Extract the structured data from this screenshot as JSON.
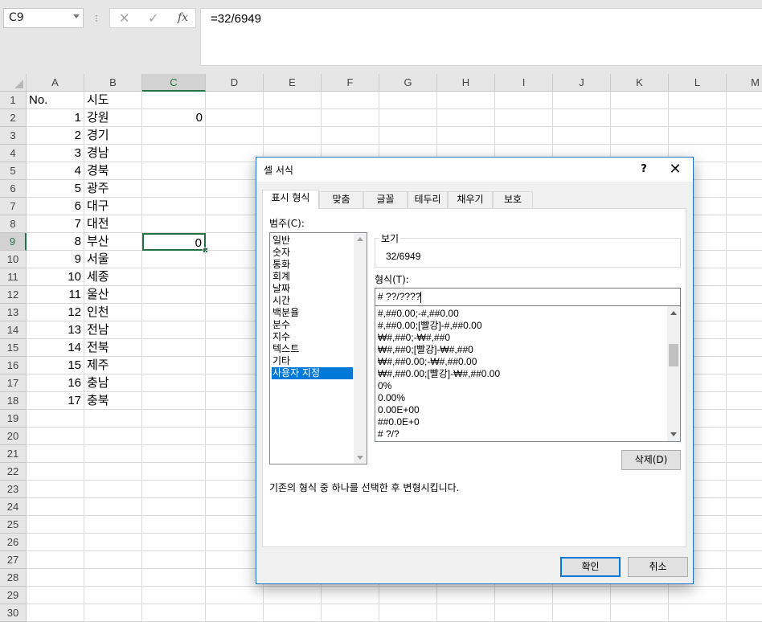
{
  "formula_bar": {
    "name_box": "C9",
    "cancel_symbol": "✕",
    "enter_symbol": "✓",
    "fx_label": "fx",
    "formula": "=32/6949"
  },
  "columns": [
    "A",
    "B",
    "C",
    "D",
    "E",
    "F",
    "G",
    "H",
    "I",
    "J",
    "K",
    "L",
    "M"
  ],
  "rows": [
    "1",
    "2",
    "3",
    "4",
    "5",
    "6",
    "7",
    "8",
    "9",
    "10",
    "11",
    "12",
    "13",
    "14",
    "15",
    "16",
    "17",
    "18",
    "19",
    "20",
    "21",
    "22",
    "23",
    "24",
    "25",
    "26",
    "27",
    "28",
    "29",
    "30"
  ],
  "selected_cell": "C9",
  "cells": {
    "A1": "No.",
    "B1": "시도",
    "A2": "1",
    "B2": "강원",
    "C2": "0",
    "A3": "2",
    "B3": "경기",
    "A4": "3",
    "B4": "경남",
    "A5": "4",
    "B5": "경북",
    "A6": "5",
    "B6": "광주",
    "A7": "6",
    "B7": "대구",
    "A8": "7",
    "B8": "대전",
    "A9": "8",
    "B9": "부산",
    "C9": "0",
    "A10": "9",
    "B10": "서울",
    "A11": "10",
    "B11": "세종",
    "A12": "11",
    "B12": "울산",
    "A13": "12",
    "B13": "인천",
    "A14": "13",
    "B14": "전남",
    "A15": "14",
    "B15": "전북",
    "A16": "15",
    "B16": "제주",
    "A17": "16",
    "B17": "충남",
    "A18": "17",
    "B18": "충북"
  },
  "dialog": {
    "title": "셀 서식",
    "help_label": "?",
    "close_label": "✕",
    "tabs": [
      "표시 형식",
      "맞춤",
      "글꼴",
      "테두리",
      "채우기",
      "보호"
    ],
    "active_tab": 0,
    "category_label": "범주(C):",
    "categories": [
      "일반",
      "숫자",
      "통화",
      "회계",
      "날짜",
      "시간",
      "백분율",
      "분수",
      "지수",
      "텍스트",
      "기타",
      "사용자 지정"
    ],
    "selected_category": 11,
    "preview_label": "보기",
    "preview_value": "32/6949",
    "type_label": "형식(T):",
    "type_value": "# ??/????",
    "format_list": [
      "#,##0.00;-#,##0.00",
      "#,##0.00;[빨강]-#,##0.00",
      "₩#,##0;-₩#,##0",
      "₩#,##0;[빨강]-₩#,##0",
      "₩#,##0.00;-₩#,##0.00",
      "₩#,##0.00;[빨강]-₩#,##0.00",
      "0%",
      "0.00%",
      "0.00E+00",
      "##0.0E+0",
      "# ?/?"
    ],
    "delete_button": "삭제(D)",
    "description": "기존의 형식 중 하나를 선택한 후 변형시킵니다.",
    "ok_button": "확인",
    "cancel_button": "취소"
  }
}
